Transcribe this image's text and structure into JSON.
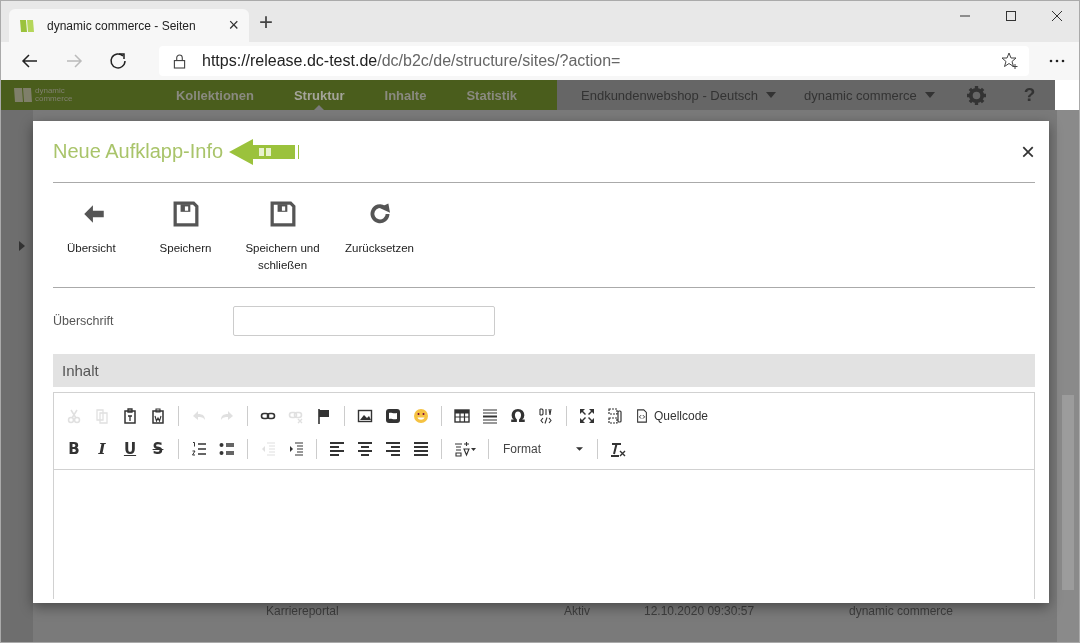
{
  "browser": {
    "tab": {
      "title": "dynamic commerce - Seiten",
      "close": "×"
    },
    "new_tab": "+",
    "url": {
      "host": "https://release.dc-test.de",
      "path": "/dc/b2c/de/structure/sites/?action="
    }
  },
  "app_nav": {
    "logo": {
      "line1": "dynamic",
      "line2": "commerce"
    },
    "items": [
      {
        "label": "Kollektionen",
        "selected": false
      },
      {
        "label": "Struktur",
        "selected": true
      },
      {
        "label": "Inhalte",
        "selected": false
      },
      {
        "label": "Statistik",
        "selected": false
      }
    ],
    "dropdowns": [
      "Endkundenwebshop - Deutsch",
      "dynamic commerce"
    ],
    "help": "?"
  },
  "background_row": {
    "name": "Karriereportal",
    "status": "Aktiv",
    "date": "12.10.2020 09:30:57",
    "user": "dynamic commerce"
  },
  "modal": {
    "title": "Neue Aufklapp-Info",
    "close": "×",
    "actions": [
      {
        "kind": "back",
        "label": "Übersicht"
      },
      {
        "kind": "save",
        "label": "Speichern"
      },
      {
        "kind": "save",
        "label": "Speichern und schließen"
      },
      {
        "kind": "reset",
        "label": "Zurücksetzen"
      }
    ],
    "field": {
      "label": "Überschrift"
    },
    "section": "Inhalt",
    "toolbar_rows": [
      [
        {
          "kind": "cut",
          "disabled": true
        },
        {
          "kind": "copy",
          "disabled": true
        },
        {
          "kind": "paste-text",
          "disabled": false
        },
        {
          "kind": "paste-word",
          "disabled": false
        },
        {
          "kind": "separator"
        },
        {
          "kind": "undo",
          "disabled": true
        },
        {
          "kind": "redo",
          "disabled": true
        },
        {
          "kind": "separator"
        },
        {
          "kind": "link",
          "disabled": false
        },
        {
          "kind": "unlink",
          "disabled": true
        },
        {
          "kind": "flag",
          "disabled": false
        },
        {
          "kind": "separator"
        },
        {
          "kind": "image",
          "disabled": false
        },
        {
          "kind": "frame",
          "disabled": false
        },
        {
          "kind": "smiley",
          "disabled": false
        },
        {
          "kind": "separator"
        },
        {
          "kind": "table",
          "disabled": false
        },
        {
          "kind": "lines",
          "disabled": false
        },
        {
          "kind": "char",
          "label": "Ω",
          "disabled": false
        },
        {
          "kind": "div",
          "disabled": false
        },
        {
          "kind": "separator"
        },
        {
          "kind": "maximize",
          "disabled": false
        },
        {
          "kind": "blocks",
          "disabled": false
        },
        {
          "kind": "source",
          "label": "Quellcode",
          "disabled": false
        }
      ],
      [
        {
          "kind": "bold",
          "label": "B",
          "disabled": false
        },
        {
          "kind": "italic",
          "label": "I",
          "disabled": false
        },
        {
          "kind": "underline",
          "label": "U",
          "disabled": false
        },
        {
          "kind": "strike",
          "label": "S",
          "disabled": false
        },
        {
          "kind": "separator"
        },
        {
          "kind": "numbered-list",
          "disabled": false
        },
        {
          "kind": "bullet-list",
          "disabled": false
        },
        {
          "kind": "separator"
        },
        {
          "kind": "outdent",
          "disabled": true
        },
        {
          "kind": "indent",
          "disabled": false
        },
        {
          "kind": "separator"
        },
        {
          "kind": "align-left",
          "disabled": false
        },
        {
          "kind": "align-center",
          "disabled": false
        },
        {
          "kind": "align-right",
          "disabled": false
        },
        {
          "kind": "justify",
          "disabled": false
        },
        {
          "kind": "separator"
        },
        {
          "kind": "language",
          "disabled": false
        },
        {
          "kind": "separator"
        },
        {
          "kind": "format",
          "label": "Format",
          "disabled": false
        },
        {
          "kind": "separator"
        },
        {
          "kind": "clear-format",
          "disabled": false
        }
      ]
    ]
  }
}
